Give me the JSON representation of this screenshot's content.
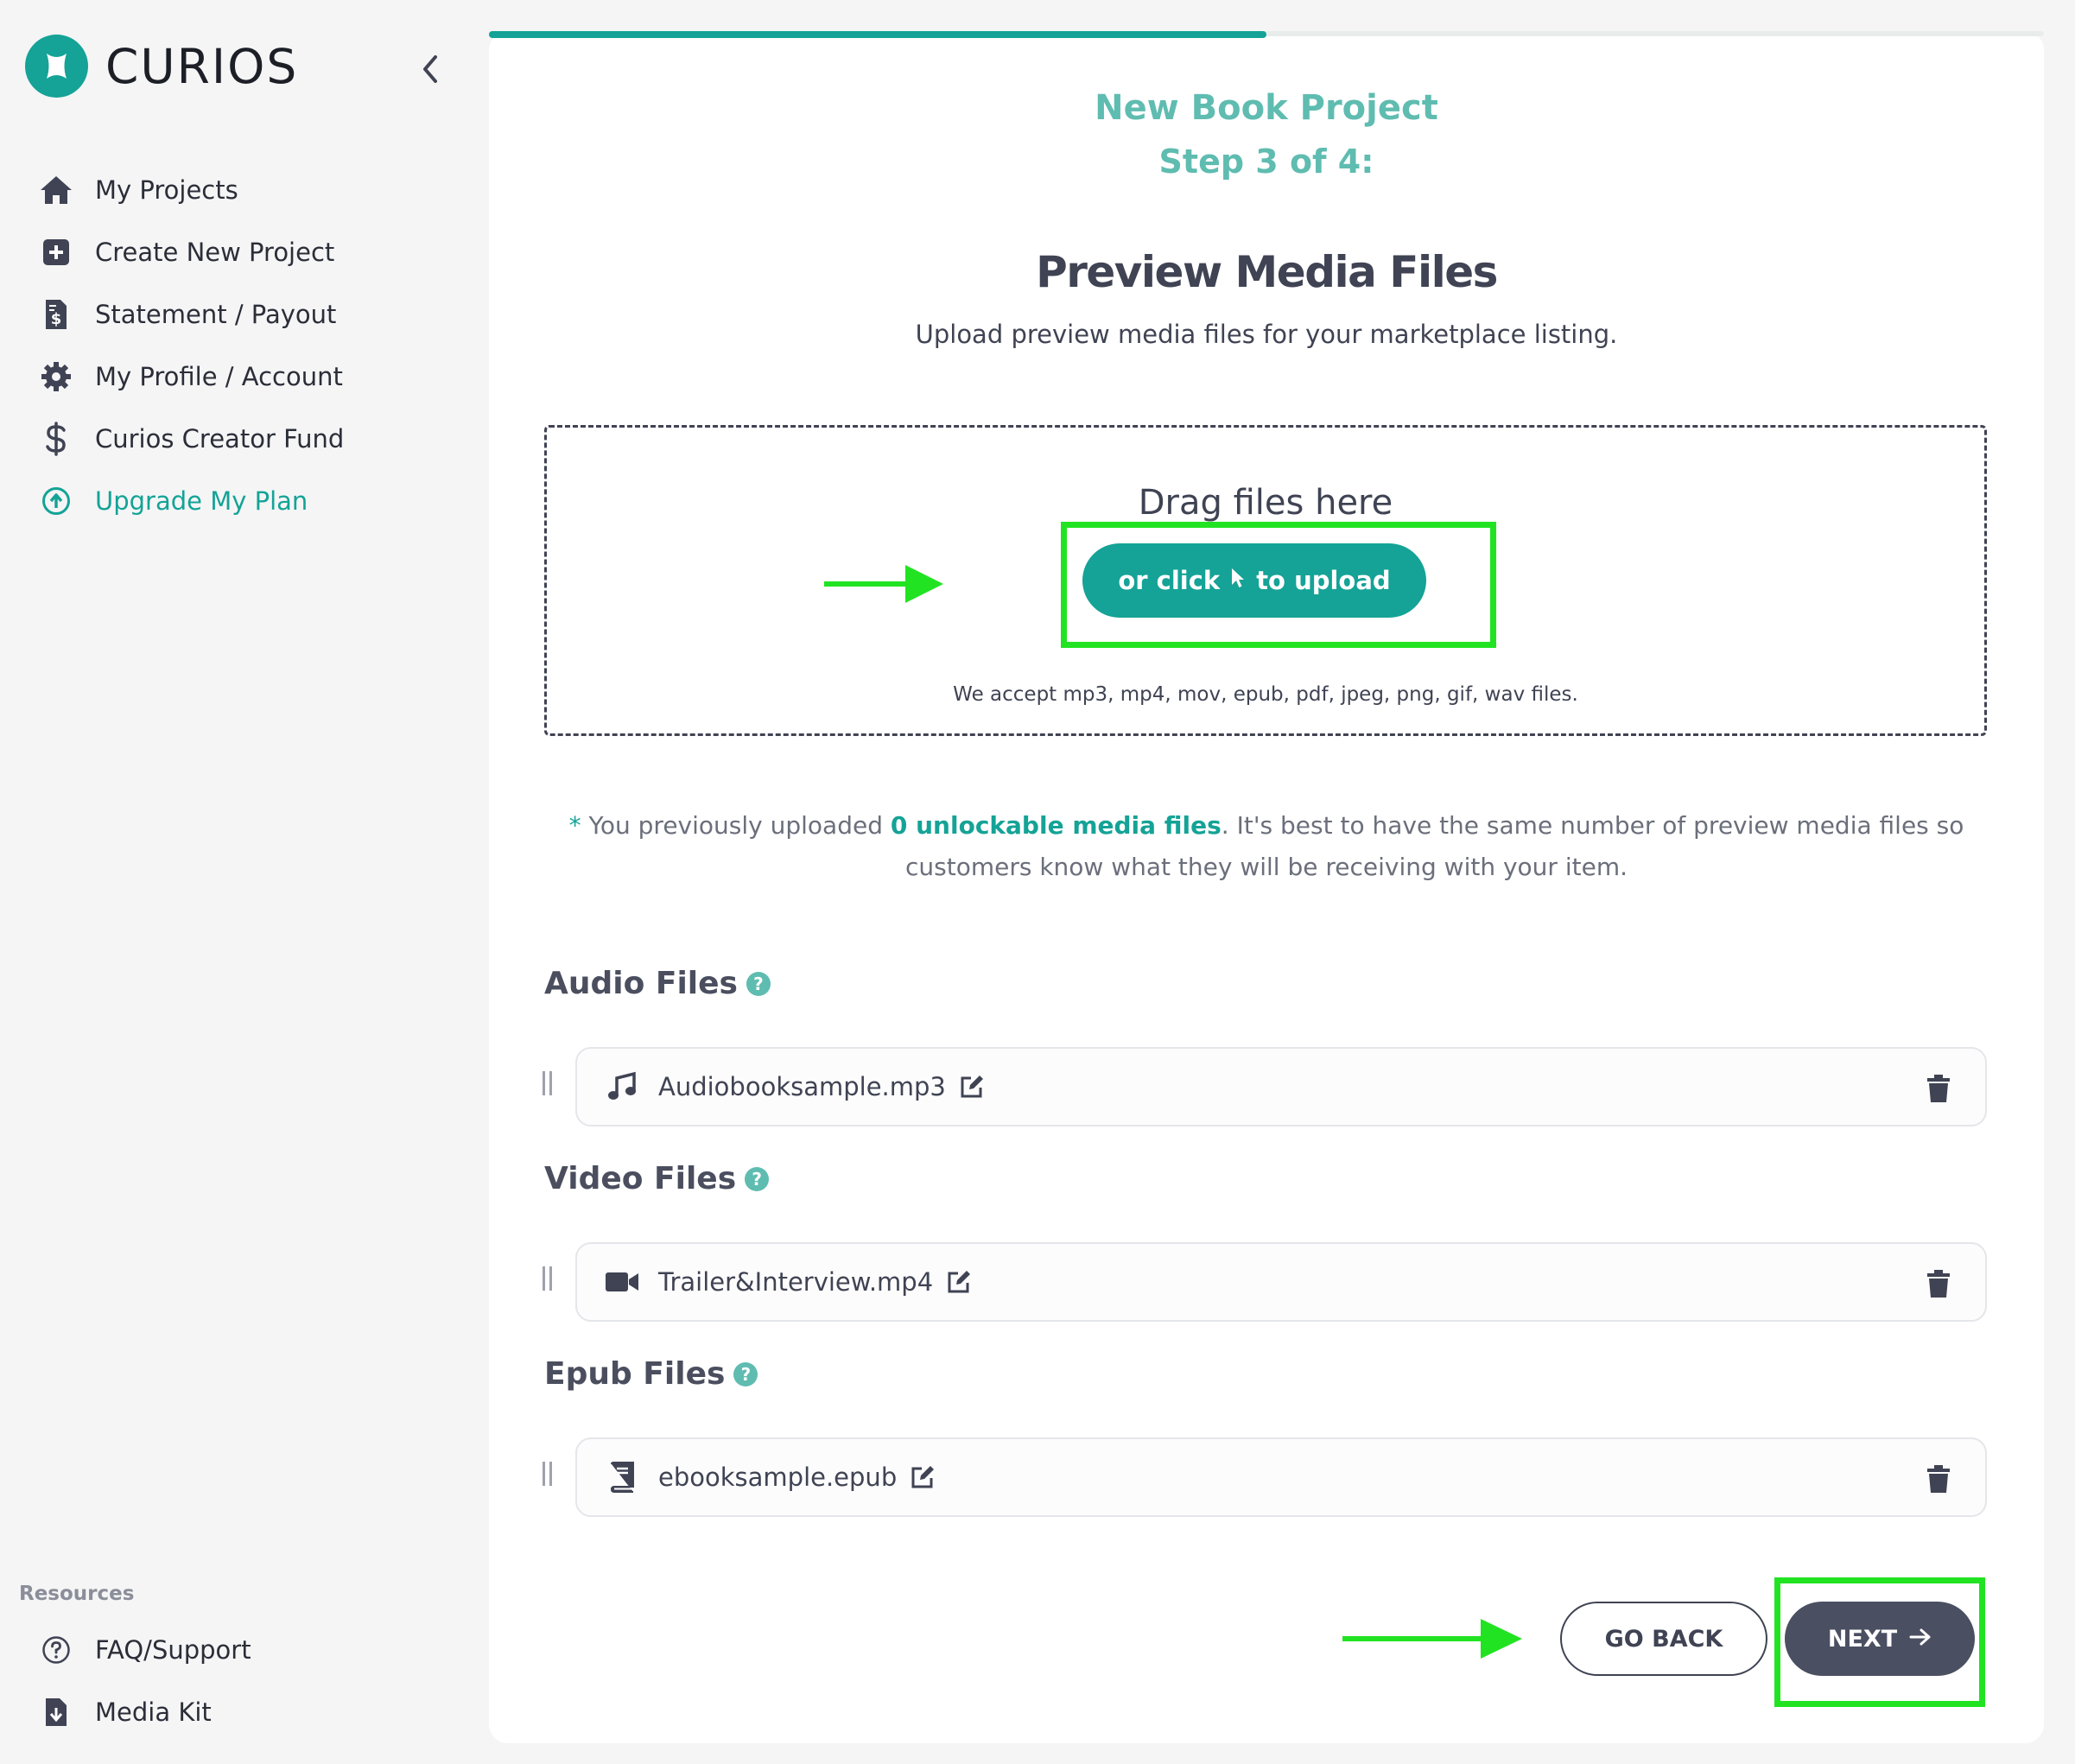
{
  "app": {
    "name": "CURIOS",
    "brand_color": "#14a396"
  },
  "sidebar": {
    "items": [
      {
        "label": "My Projects",
        "icon": "home-icon"
      },
      {
        "label": "Create New Project",
        "icon": "plus-square-icon"
      },
      {
        "label": "Statement / Payout",
        "icon": "invoice-icon"
      },
      {
        "label": "My Profile / Account",
        "icon": "gear-icon"
      },
      {
        "label": "Curios Creator Fund",
        "icon": "dollar-icon"
      },
      {
        "label": "Upgrade My Plan",
        "icon": "upgrade-circle-icon"
      }
    ],
    "resources_title": "Resources",
    "resources": [
      {
        "label": "FAQ/Support",
        "icon": "question-circle-icon"
      },
      {
        "label": "Media Kit",
        "icon": "download-file-icon"
      }
    ]
  },
  "progress": {
    "step": 3,
    "total": 4,
    "fraction": 0.5
  },
  "header": {
    "title": "New Book Project",
    "step": "Step 3 of 4:"
  },
  "section": {
    "title": "Preview Media Files",
    "subtitle": "Upload preview media files for your marketplace listing."
  },
  "dropzone": {
    "drag_text": "Drag files here",
    "button_pre": "or click",
    "button_post": "to upload",
    "accepted": "We accept mp3, mp4, mov, epub, pdf, jpeg, png, gif, wav files."
  },
  "notice": {
    "star": "*",
    "pre": " You previously uploaded ",
    "count": "0 unlockable media files",
    "post": ". It's best to have the same number of preview media files so customers know what they will be receiving with your item."
  },
  "groups": [
    {
      "title": "Audio Files",
      "file": "Audiobooksample.mp3",
      "icon": "music-note-icon"
    },
    {
      "title": "Video Files",
      "file": "Trailer&Interview.mp4",
      "icon": "video-camera-icon"
    },
    {
      "title": "Epub Files",
      "file": "ebooksample.epub",
      "icon": "book-icon"
    }
  ],
  "help_glyph": "?",
  "actions": {
    "back": "GO BACK",
    "next": "NEXT"
  },
  "annotation_color": "#22e322"
}
